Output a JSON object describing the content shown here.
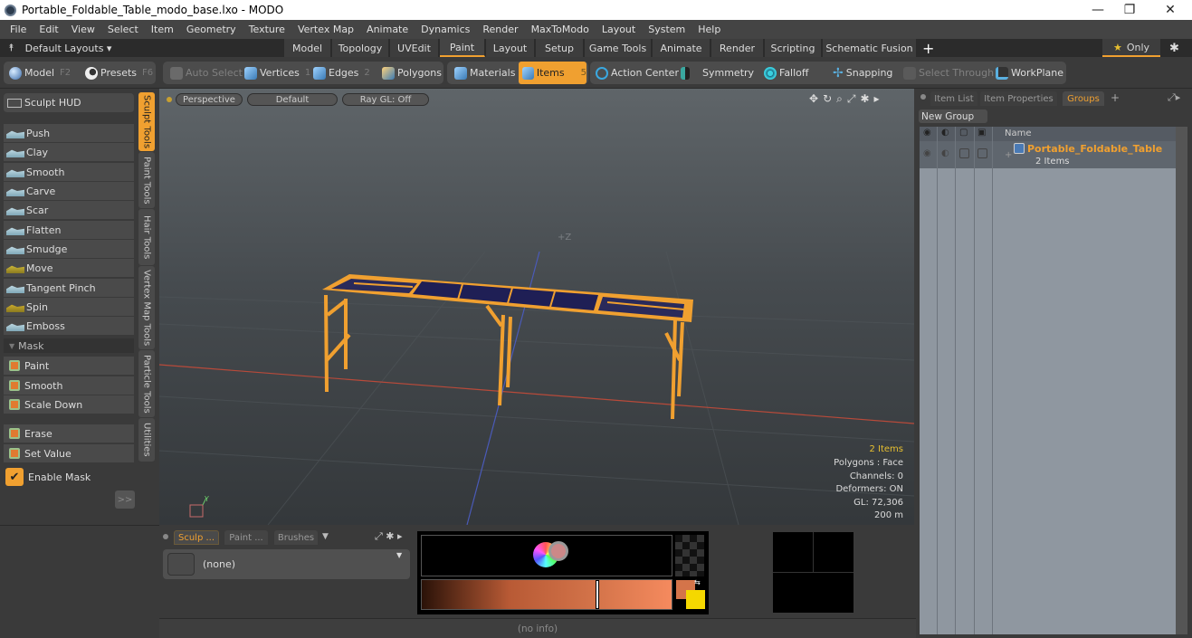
{
  "window": {
    "title": "Portable_Foldable_Table_modo_base.lxo - MODO",
    "minimize": "—",
    "restore": "❐",
    "close": "✕"
  },
  "menu": [
    "File",
    "Edit",
    "View",
    "Select",
    "Item",
    "Geometry",
    "Texture",
    "Vertex Map",
    "Animate",
    "Dynamics",
    "Render",
    "MaxToModo",
    "Layout",
    "System",
    "Help"
  ],
  "layoutbar": {
    "default_layouts": "Default Layouts ▾",
    "tabs": [
      "Model",
      "Topology",
      "UVEdit",
      "Paint",
      "Layout",
      "Setup",
      "Game Tools",
      "Animate",
      "Render",
      "Scripting",
      "Schematic Fusion"
    ],
    "active_tab": "Paint",
    "add": "+",
    "only": "Only"
  },
  "toolbar": {
    "model": "Model",
    "model_key": "F2",
    "presets": "Presets",
    "presets_key": "F6",
    "auto_select": "Auto Select",
    "vertices": "Vertices",
    "vertices_key": "1",
    "edges": "Edges",
    "edges_key": "2",
    "polygons": "Polygons",
    "materials": "Materials",
    "items": "Items",
    "items_key": "5",
    "action_center": "Action Center",
    "symmetry": "Symmetry",
    "falloff": "Falloff",
    "snapping": "Snapping",
    "select_through": "Select Through",
    "workplane": "WorkPlane"
  },
  "sculpt": {
    "hud": "Sculpt HUD",
    "tools": [
      "Push",
      "Clay",
      "Smooth",
      "Carve",
      "Scar",
      "Flatten",
      "Smudge",
      "Move",
      "Tangent Pinch",
      "Spin",
      "Emboss"
    ],
    "mask_header": "Mask",
    "mask_tools": [
      "Paint",
      "Smooth",
      "Scale Down"
    ],
    "mask_tools2": [
      "Erase",
      "Set Value"
    ],
    "enable_mask": "Enable Mask",
    "enable_mask_checked": true,
    "more": ">>"
  },
  "vtabs": [
    "Sculpt Tools",
    "Paint Tools",
    "Hair Tools",
    "Vertex Map Tools",
    "Particle Tools",
    "Utilities"
  ],
  "viewport": {
    "view": "Perspective",
    "shading": "Default",
    "raygl": "Ray GL: Off",
    "axis_label": "+Z",
    "info": {
      "items": "2 Items",
      "polygons": "Polygons : Face",
      "channels": "Channels: 0",
      "deformers": "Deformers: ON",
      "gl": "GL: 72,306",
      "scale": "200 m"
    }
  },
  "rightpanel": {
    "tabs": [
      "Item List",
      "Item Properties",
      "Groups"
    ],
    "active_tab": "Groups",
    "add": "+",
    "new_group": "New Group",
    "name_header": "Name",
    "group": {
      "name": "Portable_Foldable_Table",
      "count": "2 Items"
    }
  },
  "bottom": {
    "tabs": [
      "Sculp ...",
      "Paint ...",
      "Brushes"
    ],
    "brush": "(none)",
    "status": "(no info)"
  },
  "colors": {
    "accent": "#f0a030",
    "fg_color": "#d4744a",
    "bg_color": "#f5d800"
  }
}
